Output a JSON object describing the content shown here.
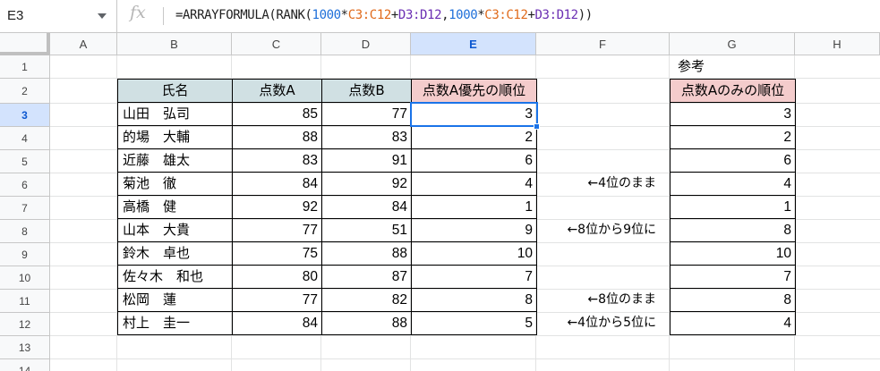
{
  "name_box": "E3",
  "formula_bar": {
    "fx_icon": "fx-icon",
    "formula": "=ARRAYFORMULA(RANK(1000*C3:C12+D3:D12,1000*C3:C12+D3:D12))",
    "parts": {
      "p1": "=ARRAYFORMULA(RANK(",
      "n1": "1000",
      "s1": "*",
      "r1": "C3:C12",
      "s2": "+",
      "r2": "D3:D12",
      "s3": ",",
      "n2": "1000",
      "s4": "*",
      "r3": "C3:C12",
      "s5": "+",
      "r4": "D3:D12",
      "p2": "))"
    }
  },
  "columns": [
    "A",
    "B",
    "C",
    "D",
    "E",
    "F",
    "G",
    "H"
  ],
  "rows": [
    "1",
    "2",
    "3",
    "4",
    "5",
    "6",
    "7",
    "8",
    "9",
    "10",
    "11",
    "12",
    "13",
    "14"
  ],
  "selected_cell": {
    "column": "E",
    "row": "3"
  },
  "colors": {
    "header_blue": "#d0e0e3",
    "header_pink": "#f4cccc",
    "selection": "#1a73e8"
  },
  "table": {
    "headers": {
      "name": "氏名",
      "score_a": "点数A",
      "score_b": "点数B",
      "rank_a_priority": "点数A優先の順位"
    },
    "rows": [
      {
        "name": "山田　弘司",
        "a": "85",
        "b": "77",
        "rank": "3",
        "note": "",
        "rank_a_only": "3"
      },
      {
        "name": "的場　大輔",
        "a": "88",
        "b": "83",
        "rank": "2",
        "note": "",
        "rank_a_only": "2"
      },
      {
        "name": "近藤　雄太",
        "a": "83",
        "b": "91",
        "rank": "6",
        "note": "",
        "rank_a_only": "6"
      },
      {
        "name": "菊池　徹",
        "a": "84",
        "b": "92",
        "rank": "4",
        "note": "←4位のまま",
        "rank_a_only": "4"
      },
      {
        "name": "高橋　健",
        "a": "92",
        "b": "84",
        "rank": "1",
        "note": "",
        "rank_a_only": "1"
      },
      {
        "name": "山本　大貴",
        "a": "77",
        "b": "51",
        "rank": "9",
        "note": "←8位から9位に",
        "rank_a_only": "8"
      },
      {
        "name": "鈴木　卓也",
        "a": "75",
        "b": "88",
        "rank": "10",
        "note": "",
        "rank_a_only": "10"
      },
      {
        "name": "佐々木　和也",
        "a": "80",
        "b": "87",
        "rank": "7",
        "note": "",
        "rank_a_only": "7"
      },
      {
        "name": "松岡　蓮",
        "a": "77",
        "b": "82",
        "rank": "8",
        "note": "←8位のまま",
        "rank_a_only": "8"
      },
      {
        "name": "村上　圭一",
        "a": "84",
        "b": "88",
        "rank": "5",
        "note": "←4位から5位に",
        "rank_a_only": "4"
      }
    ]
  },
  "reference": {
    "label": "参考",
    "header": "点数Aのみの順位"
  }
}
